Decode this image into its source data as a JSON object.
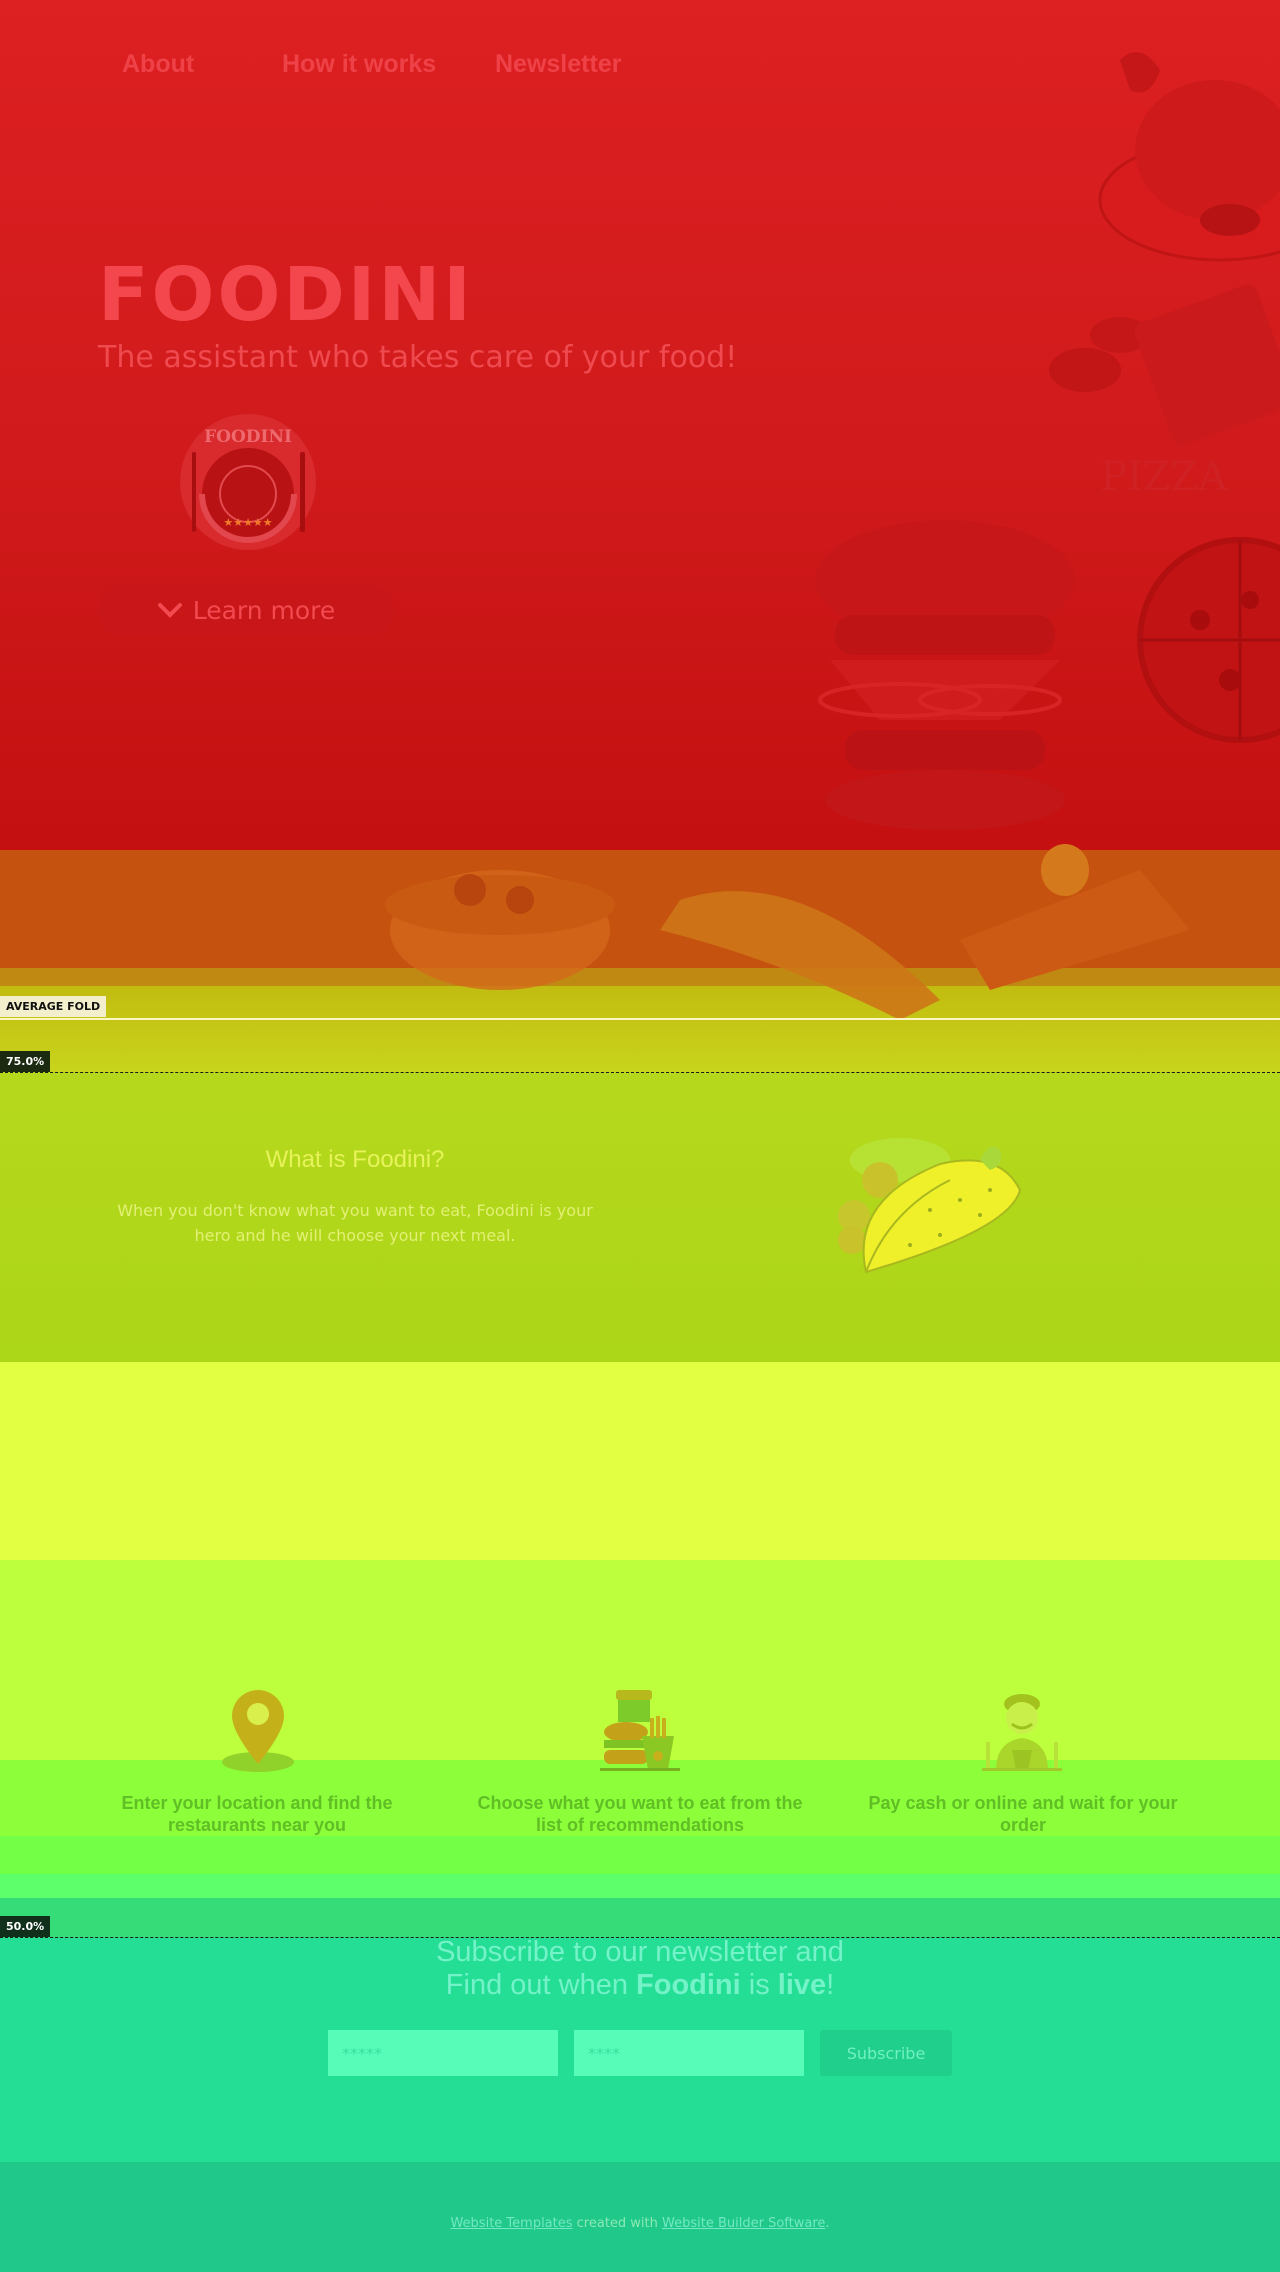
{
  "nav": {
    "items": [
      {
        "label": "About"
      },
      {
        "label": "How it works"
      },
      {
        "label": "Newsletter"
      }
    ]
  },
  "hero": {
    "brand": "FOODINI",
    "tagline": "The assistant who takes care of your food!",
    "logo_text": "FOODINI",
    "learn_more": "Learn more",
    "learn_more_icon": "chevron-down-icon"
  },
  "folds": {
    "average": "AVERAGE FOLD",
    "p75": "75.0%",
    "p50": "50.0%"
  },
  "about": {
    "title": "What is Foodini?",
    "text": "When you don't know what you want to eat, Foodini is your hero and he will choose your next meal."
  },
  "steps": [
    {
      "icon": "location-pin-icon",
      "text": "Enter your location and find the restaurants near you"
    },
    {
      "icon": "fast-food-icon",
      "text": "Choose what you want to eat from the list of recommendations"
    },
    {
      "icon": "waiter-icon",
      "text": "Pay cash or online and wait for your order"
    }
  ],
  "newsletter": {
    "line1": "Subscribe to our newsletter and",
    "line2_pre": "Find out when ",
    "line2_brand": "Foodini",
    "line2_mid": " is ",
    "line2_live": "live",
    "line2_end": "!",
    "name_placeholder": "*****",
    "email_placeholder": "****",
    "submit": "Subscribe"
  },
  "footer": {
    "link1": "Website Templates",
    "middle": " created with ",
    "link2": "Website Builder Software",
    "end": "."
  },
  "colors": {
    "hero_red": "#d01a1b",
    "brand_text": "#f4474d",
    "teal": "#24de96"
  }
}
